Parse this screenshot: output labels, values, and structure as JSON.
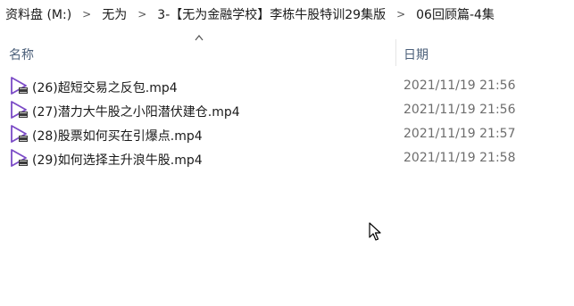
{
  "breadcrumb": [
    {
      "label": "资料盘 (M:)"
    },
    {
      "label": "无为"
    },
    {
      "label": "3-【无为金融学校】李栋牛股特训29集版"
    },
    {
      "label": "06回顾篇-4集"
    }
  ],
  "columns": {
    "name": "名称",
    "date": "日期"
  },
  "files": [
    {
      "name": "(26)超短交易之反包.mp4",
      "date": "2021/11/19 21:56"
    },
    {
      "name": "(27)潜力大牛股之小阳潜伏建仓.mp4",
      "date": "2021/11/19 21:56"
    },
    {
      "name": "(28)股票如何买在引爆点.mp4",
      "date": "2021/11/19 21:57"
    },
    {
      "name": "(29)如何选择主升浪牛股.mp4",
      "date": "2021/11/19 21:58"
    }
  ],
  "icons": {
    "file": "video-file-icon",
    "separator": "chevron-right-icon",
    "sort": "sort-ascending-icon"
  },
  "colors": {
    "header_text": "#4c607a",
    "date_text": "#6d6d6d",
    "icon_accent": "#7b4bc6"
  }
}
